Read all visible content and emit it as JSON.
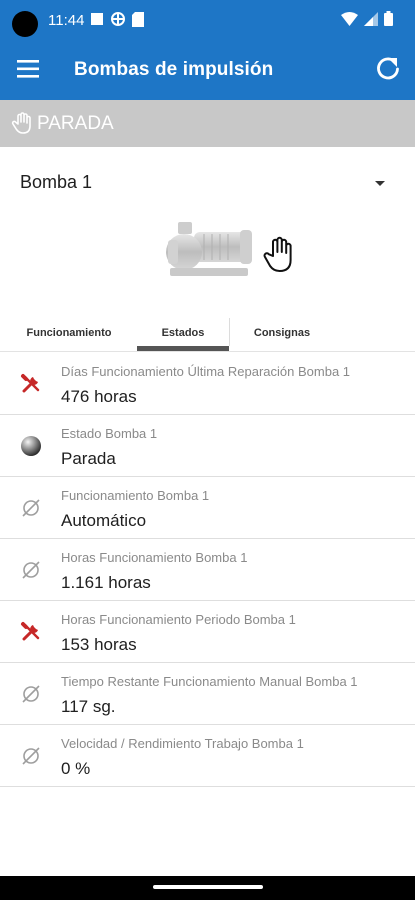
{
  "status_bar": {
    "time": "11:44"
  },
  "app_bar": {
    "title": "Bombas de impulsión",
    "menu_icon": "menu-icon",
    "refresh_icon": "refresh-icon"
  },
  "state_banner": {
    "label": "PARADA",
    "icon": "hand-icon"
  },
  "pump_selector": {
    "selected": "Bomba 1"
  },
  "tabs": [
    {
      "label": "Funcionamiento",
      "active": false
    },
    {
      "label": "Estados",
      "active": true
    },
    {
      "label": "Consignas",
      "active": false
    }
  ],
  "rows": [
    {
      "icon": "wrench-icon",
      "label": "Días Funcionamiento Última Reparación Bomba 1",
      "value": "476 horas"
    },
    {
      "icon": "sphere-icon",
      "label": "Estado Bomba 1",
      "value": "Parada"
    },
    {
      "icon": "empty-set-icon",
      "label": "Funcionamiento Bomba 1",
      "value": "Automático"
    },
    {
      "icon": "empty-set-icon",
      "label": "Horas Funcionamiento Bomba 1",
      "value": "1.161 horas"
    },
    {
      "icon": "wrench-icon",
      "label": "Horas Funcionamiento Periodo Bomba 1",
      "value": "153 horas"
    },
    {
      "icon": "empty-set-icon",
      "label": "Tiempo Restante Funcionamiento Manual Bomba 1",
      "value": "117 sg."
    },
    {
      "icon": "empty-set-icon",
      "label": "Velocidad / Rendimiento Trabajo Bomba 1",
      "value": "0 %"
    }
  ],
  "colors": {
    "primary": "#1e76c6",
    "banner": "#c8c8c8",
    "wrench": "#c62828",
    "muted": "#8a8a8a"
  }
}
